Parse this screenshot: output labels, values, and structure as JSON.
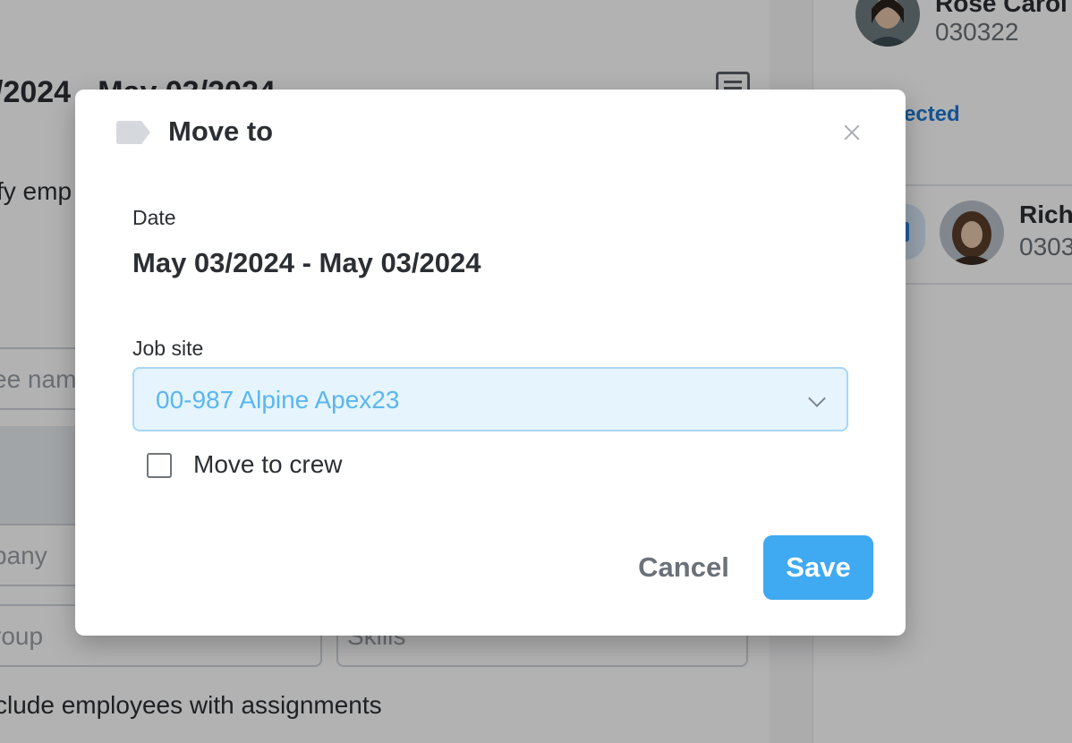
{
  "background": {
    "date_range_fragment": "/2024 - May 03/2024",
    "instruction_fragment": "fy emp",
    "name_placeholder_fragment": "ee nam",
    "company_placeholder_fragment": "pany",
    "group_placeholder_fragment": "roup",
    "skills_placeholder": "Skills",
    "include_assignments_fragment": "clude employees with assignments",
    "person1_name_fragment": "Rose Carol",
    "person1_id": "030322",
    "selected_link_fragment": "ected",
    "person2_name_fragment": "Rich",
    "person2_id_fragment": "0303"
  },
  "modal": {
    "title": "Move to",
    "tag_icon": "tag-icon",
    "close_icon": "close-icon",
    "date_label": "Date",
    "date_value": "May 03/2024 - May 03/2024",
    "job_site_label": "Job site",
    "job_site_value": "00-987 Alpine Apex23",
    "move_to_crew_label": "Move to crew",
    "move_to_crew_checked": false,
    "cancel_label": "Cancel",
    "save_label": "Save",
    "accent_color": "#3fa9f1"
  }
}
